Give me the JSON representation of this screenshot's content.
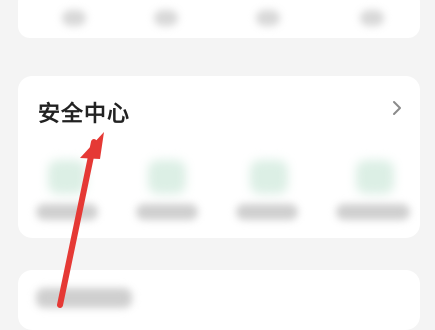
{
  "security_section": {
    "title": "安全中心"
  },
  "icons": {
    "chevron": "chevron-right-icon",
    "annotation": "red-arrow-annotation"
  },
  "colors": {
    "arrow": "#e53935",
    "background": "#f4f4f4",
    "card": "#ffffff"
  }
}
